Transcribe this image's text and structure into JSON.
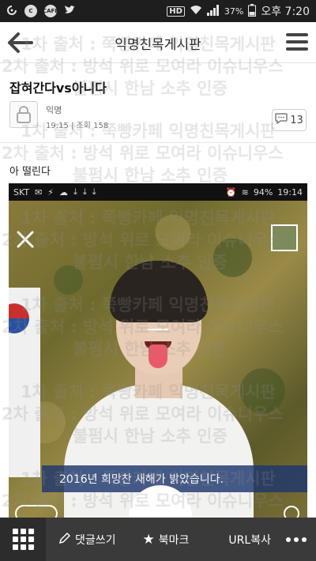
{
  "status_bar": {
    "app_icons": [
      "swirl-icon",
      "c-app-icon",
      "cafe-icon",
      "twitter-icon"
    ],
    "cafe_label": "CAFE",
    "hd_label": "HD",
    "battery_text": "37%",
    "time": "오후 7:20"
  },
  "header": {
    "title": "익명친목게시판"
  },
  "post": {
    "title": "잡혀간다vs아니다",
    "author": "익명",
    "meta": "19:15 | 조회 158",
    "comment_count": "13",
    "body": "아 떨린다"
  },
  "embedded_screenshot": {
    "carrier": "SKT",
    "battery": "94%",
    "time": "19:14",
    "caption": "2016년 희망찬 새해가 밝았습니다."
  },
  "watermark": {
    "line1": "1차 출처 : 쭉빵카페 익명친목게시판",
    "line2": "2차 출처 : 방석 위로 모여라 이슈니우스",
    "line3": "불펌시 한남 소추 인증"
  },
  "bottom_bar": {
    "comment_label": "댓글쓰기",
    "bookmark_label": "북마크",
    "url_label": "URL복사"
  },
  "colors": {
    "status_bar_bg": "#1e1e1e",
    "bottom_bar_bg": "#3a3a3a",
    "caption_bg": "#1e376e"
  }
}
